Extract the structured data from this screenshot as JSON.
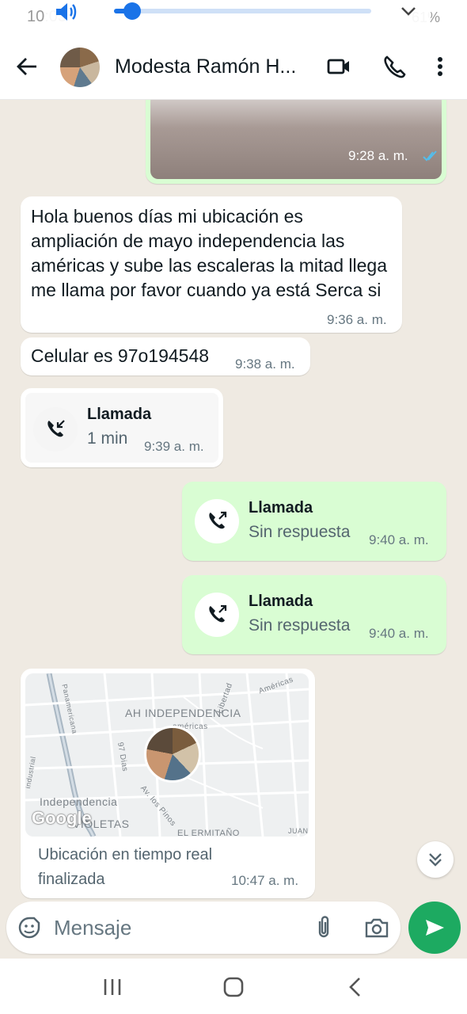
{
  "status": {
    "time": "10:03",
    "battery": "61%"
  },
  "volume": {
    "level": 0.07
  },
  "header": {
    "contact_name": "Modesta Ramón H..."
  },
  "messages": [
    {
      "kind": "image",
      "direction": "out",
      "time": "9:28 a. m."
    },
    {
      "kind": "text",
      "direction": "in",
      "text": "Hola buenos días mi ubicación es ampliación de mayo independencia las américas y sube las escaleras la mitad llega me llama por favor cuando ya está Serca si",
      "time": "9:36 a. m."
    },
    {
      "kind": "text",
      "direction": "in",
      "text": "Celular es 97o194548",
      "time": "9:38 a. m."
    },
    {
      "kind": "call",
      "direction": "in",
      "title": "Llamada",
      "subtitle": "1 min",
      "time": "9:39 a. m."
    },
    {
      "kind": "call",
      "direction": "out",
      "title": "Llamada",
      "subtitle": "Sin respuesta",
      "time": "9:40 a. m."
    },
    {
      "kind": "call",
      "direction": "out",
      "title": "Llamada",
      "subtitle": "Sin respuesta",
      "time": "9:40 a. m."
    },
    {
      "kind": "location",
      "direction": "in",
      "caption": "Ubicación en tiempo real finalizada",
      "time": "10:47 a. m."
    }
  ],
  "map": {
    "labels": {
      "area": "AH INDEPENDENCIA",
      "street1": "Libertad",
      "street2": "Américas",
      "street3": "américas",
      "street4": "97 Dias",
      "street5": "Independencia",
      "street6": "Av. los Pinos",
      "street7": "VIOLETAS",
      "street8": "EL ERMITAÑO",
      "street9": "JUAN D",
      "street10": "Panamericana",
      "street11": "industrial"
    },
    "google": "Google"
  },
  "composer": {
    "placeholder": "Mensaje"
  },
  "colors": {
    "accent": "#1daa61",
    "outgoing_bubble": "#d9fdd3",
    "incoming_bubble": "#ffffff",
    "volume": "#1a73e8"
  },
  "icons": [
    "volume-icon",
    "chevron-down-icon",
    "back-arrow-icon",
    "video-call-icon",
    "phone-icon",
    "more-vert-icon",
    "incoming-call-icon",
    "outgoing-call-icon",
    "scroll-down-icon",
    "sticker-icon",
    "attach-icon",
    "camera-icon",
    "send-icon",
    "recents-icon",
    "home-icon",
    "nav-back-icon"
  ]
}
